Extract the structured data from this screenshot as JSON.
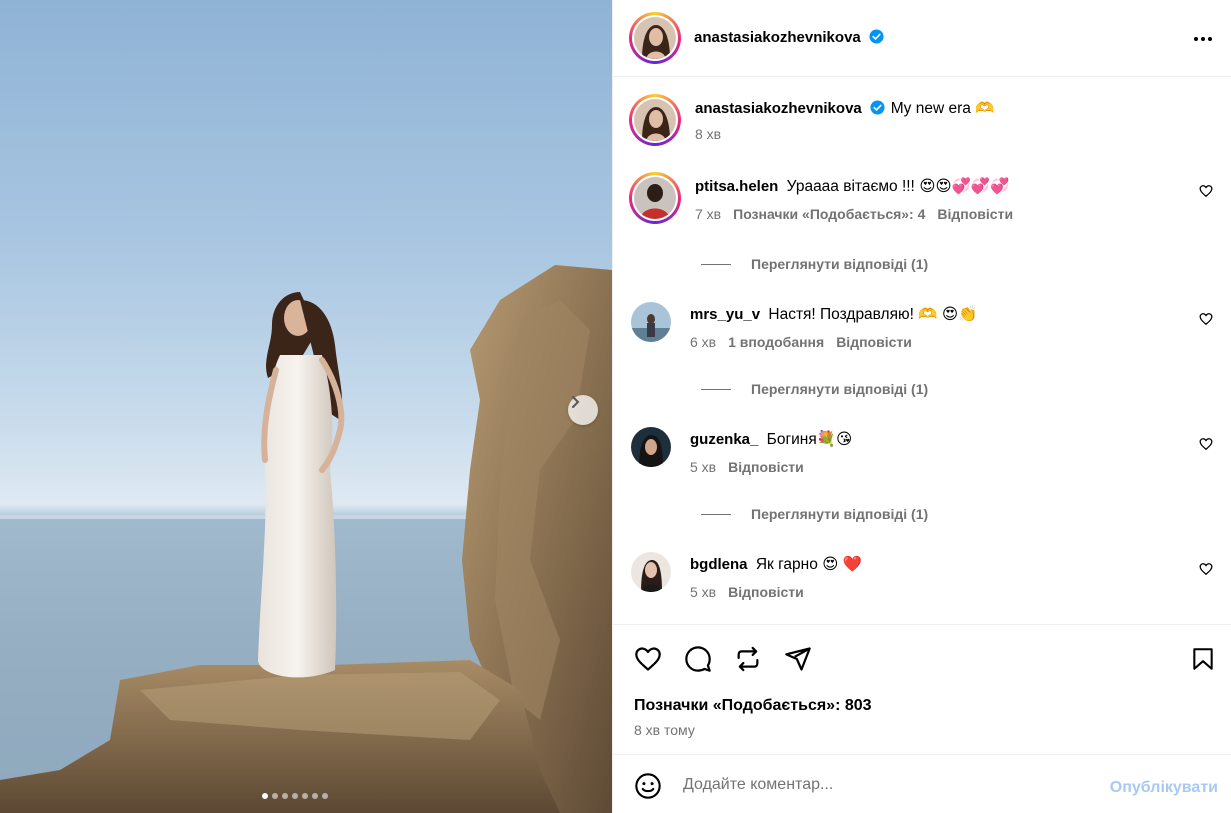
{
  "post": {
    "author": "anastasiakozhevnikova",
    "caption": "My new era 🫶",
    "caption_time": "8 хв",
    "carousel": {
      "total_slides": 7,
      "active_slide": 1
    }
  },
  "comments": [
    {
      "user": "ptitsa.helen",
      "text": "Урaaaa вітаємо !!!",
      "time": "7 хв",
      "likes": "Позначки «Подобається»: 4",
      "reply": "Відповісти",
      "view_replies": "Переглянути відповіді (1)"
    },
    {
      "user": "mrs_yu_v",
      "text": "Настя! Поздравляю! 🫶",
      "time": "6 хв",
      "likes": "1 вподобання",
      "reply": "Відповісти",
      "view_replies": "Переглянути відповіді (1)"
    },
    {
      "user": "guzenka_",
      "text": "Богиня",
      "time": "5 хв",
      "reply": "Відповісти",
      "view_replies": "Переглянути відповіді (1)"
    },
    {
      "user": "bgdlena",
      "text": "Як гарно",
      "time": "5 хв",
      "reply": "Відповісти"
    }
  ],
  "stats": {
    "likes": "Позначки «Подобається»: 803",
    "time_ago": "8 хв тому"
  },
  "composer": {
    "placeholder": "Додайте коментар...",
    "post_label": "Опублікувати"
  },
  "colors": {
    "verified": "#0095f6",
    "muted_text": "#737373",
    "post_button_disabled": "#a8c9f5",
    "heart_red": "#e0245e"
  }
}
